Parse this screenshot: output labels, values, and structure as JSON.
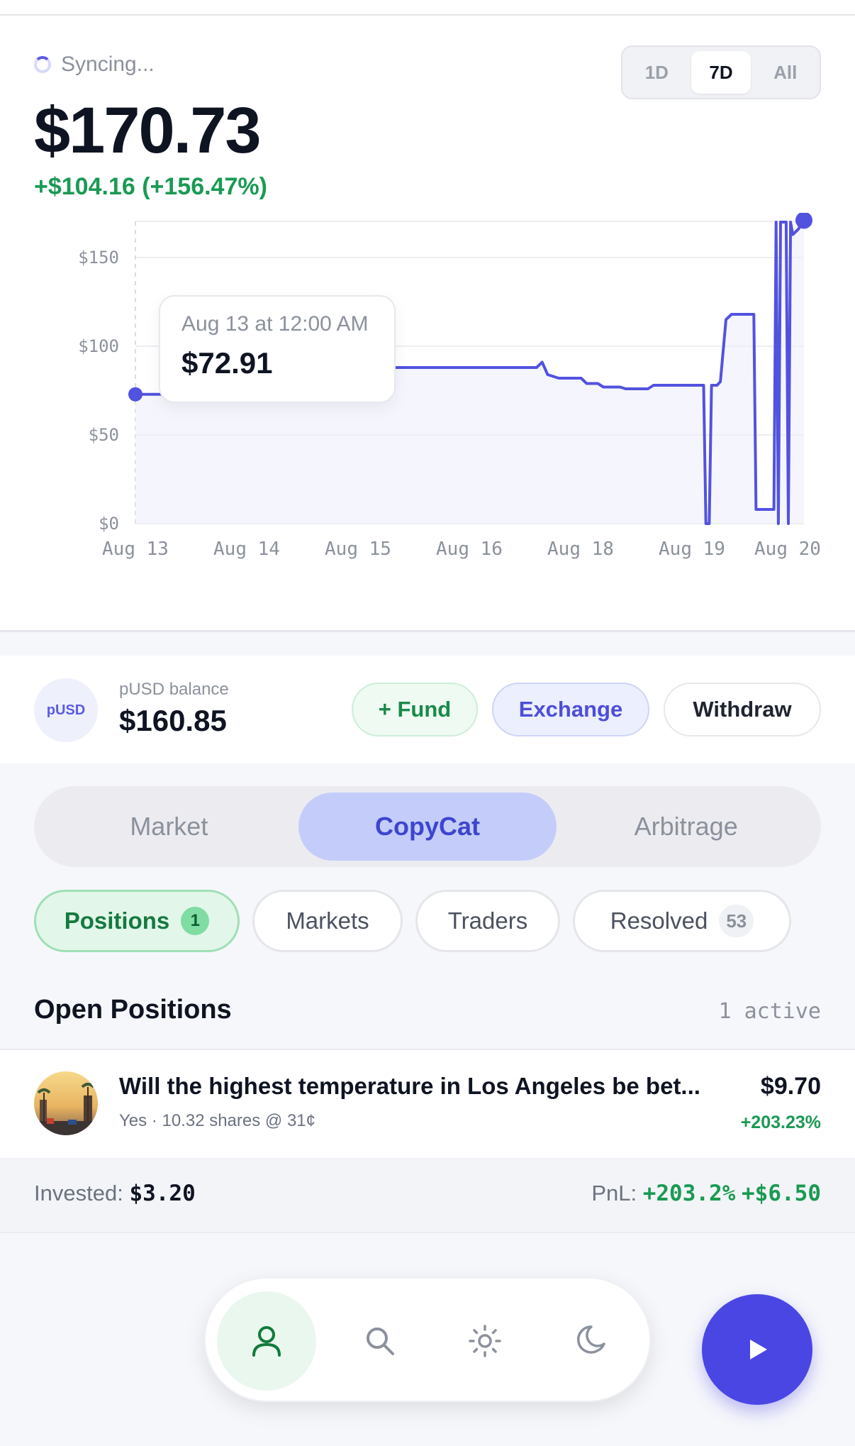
{
  "status": {
    "label": "Syncing..."
  },
  "portfolio": {
    "value": "$170.73",
    "change": "+$104.16 (+156.47%)"
  },
  "range_selector": {
    "options": [
      "1D",
      "7D",
      "All"
    ],
    "selected": "7D"
  },
  "tooltip": {
    "date": "Aug 13 at 12:00 AM",
    "value": "$72.91"
  },
  "chart_data": {
    "type": "line",
    "title": "",
    "xlabel": "",
    "ylabel": "",
    "x_ticks": [
      "Aug 13",
      "Aug 14",
      "Aug 15",
      "Aug 16",
      "Aug 18",
      "Aug 19",
      "Aug 20"
    ],
    "y_ticks": [
      "$150",
      "$100",
      "$50",
      "$0"
    ],
    "ylim": [
      0,
      170
    ],
    "grid": true,
    "series": [
      {
        "color": "#5252e0",
        "points": [
          [
            0,
            72.9
          ],
          [
            0.55,
            72.9
          ],
          [
            0.7,
            73.5
          ],
          [
            1.6,
            88
          ],
          [
            3.6,
            88
          ],
          [
            3.65,
            91
          ],
          [
            3.7,
            84
          ],
          [
            3.8,
            82
          ],
          [
            4.0,
            82
          ],
          [
            4.05,
            79
          ],
          [
            4.15,
            79
          ],
          [
            4.2,
            77
          ],
          [
            4.35,
            77
          ],
          [
            4.4,
            76
          ],
          [
            4.6,
            76
          ],
          [
            4.65,
            78
          ],
          [
            5.1,
            78
          ],
          [
            5.12,
            0
          ],
          [
            5.15,
            0
          ],
          [
            5.17,
            78
          ],
          [
            5.22,
            78
          ],
          [
            5.25,
            80
          ],
          [
            5.3,
            115
          ],
          [
            5.35,
            118
          ],
          [
            5.55,
            118
          ],
          [
            5.57,
            8
          ],
          [
            5.73,
            8
          ],
          [
            5.75,
            170
          ],
          [
            5.77,
            0
          ],
          [
            5.79,
            170
          ],
          [
            5.84,
            170
          ],
          [
            5.86,
            0
          ],
          [
            5.88,
            170
          ],
          [
            5.9,
            163
          ],
          [
            5.95,
            166
          ],
          [
            6.0,
            171
          ]
        ]
      }
    ]
  },
  "wallet": {
    "coin": "pUSD",
    "label": "pUSD balance",
    "value": "$160.85",
    "buttons": {
      "fund": "+ Fund",
      "exchange": "Exchange",
      "withdraw": "Withdraw"
    }
  },
  "modes": {
    "items": [
      "Market",
      "CopyCat",
      "Arbitrage"
    ],
    "selected": "CopyCat"
  },
  "filters": [
    {
      "label": "Positions",
      "badge": "1",
      "active": true
    },
    {
      "label": "Markets"
    },
    {
      "label": "Traders"
    },
    {
      "label": "Resolved",
      "badge": "53"
    }
  ],
  "section": {
    "title": "Open Positions",
    "count": "1 active"
  },
  "positions": [
    {
      "title": "Will the highest temperature in Los Angeles be bet...",
      "subtitle": "Yes · 10.32 shares @ 31¢",
      "value": "$9.70",
      "pct": "+203.23%"
    }
  ],
  "summary": {
    "invested_label": "Invested:",
    "invested_value": "$3.20",
    "pnl_label": "PnL:",
    "pnl_pct": "+203.2%",
    "pnl_value": "+$6.50"
  },
  "nav": {
    "items": [
      "user-icon",
      "search-icon",
      "sun-icon",
      "moon-icon"
    ],
    "active": "user-icon"
  },
  "colors": {
    "accent": "#4a46e3",
    "positive": "#1a9a53",
    "line": "#5252e0"
  }
}
